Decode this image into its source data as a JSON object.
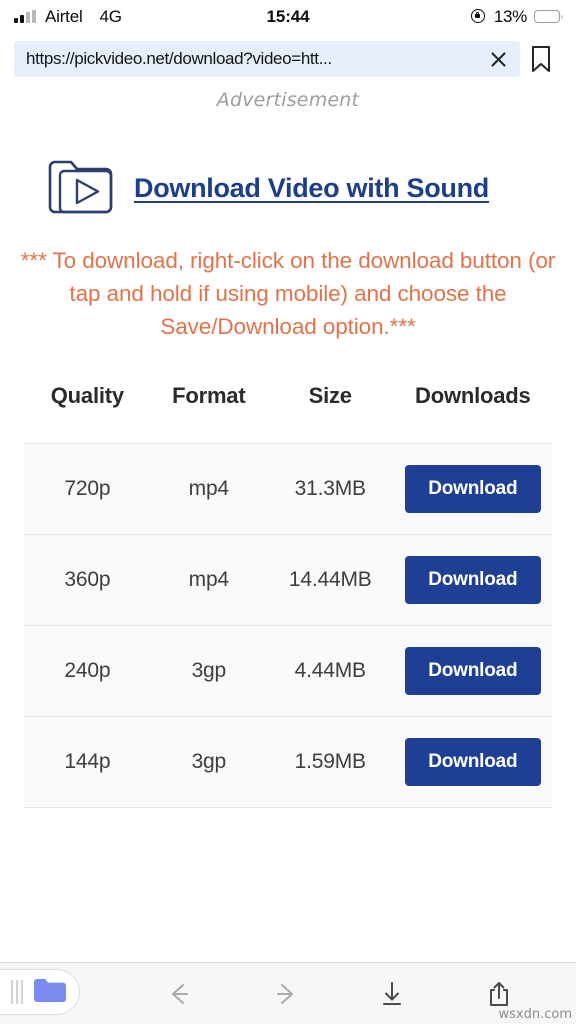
{
  "status_bar": {
    "carrier": "Airtel",
    "network_type": "4G",
    "time": "15:44",
    "battery_percent": "13%",
    "battery_level": 13,
    "signal_bars_active": 2,
    "signal_bars_total": 4,
    "rotation_lock_icon": "rotation-lock-icon"
  },
  "browser": {
    "url": "https://pickvideo.net/download?video=htt...",
    "url_placeholder": "Search or enter website name",
    "clear_icon": "close-icon",
    "bookmark_icon": "bookmark-icon",
    "url_field_bg": "#e6eefb"
  },
  "page": {
    "ad_label": "Advertisement",
    "promo": {
      "icon": "video-folder-icon",
      "link_text": "Download Video with Sound",
      "link_color": "#1d3f8a"
    },
    "notice": "*** To download, right-click on the download button (or tap and hold if using mobile) and choose the Save/Download option.***",
    "notice_color": "#e1734a",
    "table": {
      "headers": [
        "Quality",
        "Format",
        "Size",
        "Downloads"
      ],
      "rows": [
        {
          "quality": "720p",
          "format": "mp4",
          "size": "31.3MB",
          "action": "Download"
        },
        {
          "quality": "360p",
          "format": "mp4",
          "size": "14.44MB",
          "action": "Download"
        },
        {
          "quality": "240p",
          "format": "3gp",
          "size": "4.44MB",
          "action": "Download"
        },
        {
          "quality": "144p",
          "format": "3gp",
          "size": "1.59MB",
          "action": "Download"
        }
      ],
      "button_color": "#1f3f94"
    }
  },
  "toolbar": {
    "tabs_icon": "tabs-folder-icon",
    "back_icon": "arrow-left-icon",
    "forward_icon": "arrow-right-icon",
    "downloads_icon": "download-icon",
    "share_icon": "share-icon"
  },
  "watermark": "wsxdn.com"
}
